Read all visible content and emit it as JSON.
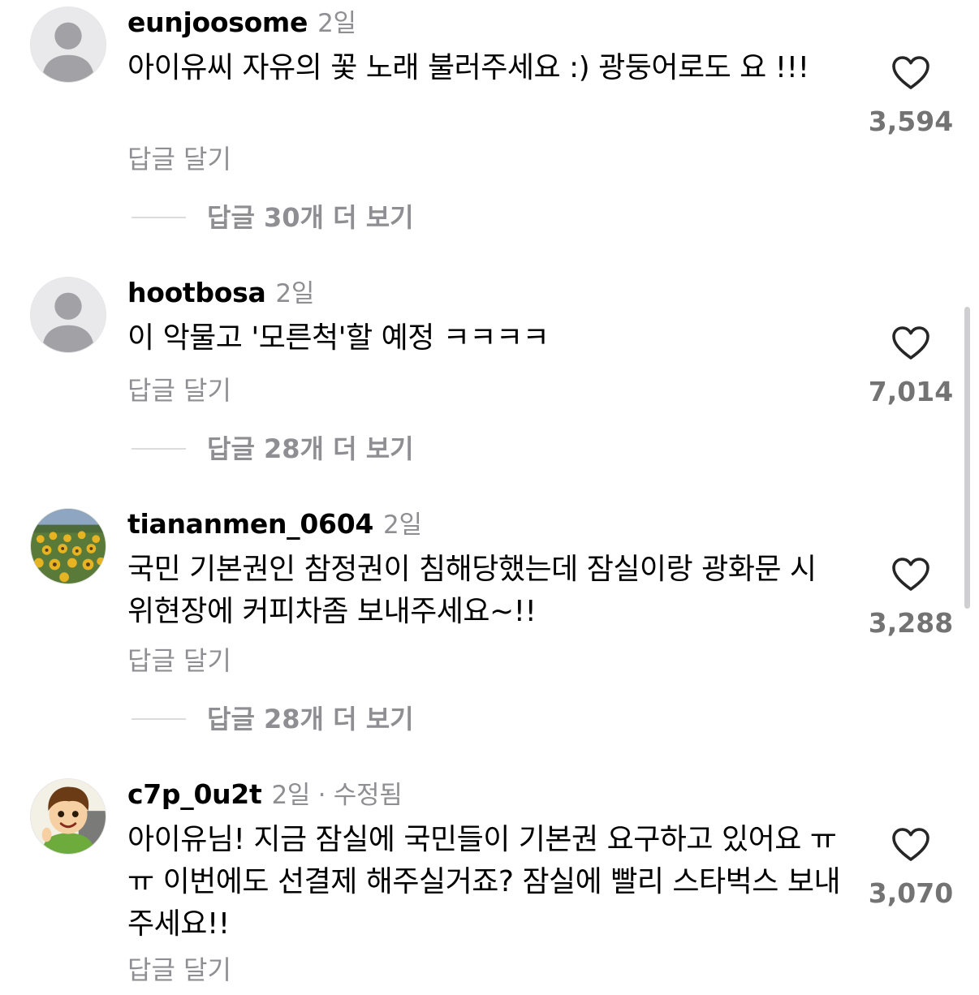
{
  "reply_label": "답글 달기",
  "comments": [
    {
      "username": "eunjoosome",
      "time": "2일",
      "edited": "",
      "text": "아이유씨 자유의 꽃 노래 불러주세요 :) 광둥어로도 요 !!!",
      "likes": "3,594",
      "more_replies": "답글 30개 더 보기"
    },
    {
      "username": "hootbosa",
      "time": "2일",
      "edited": "",
      "text": "이 악물고 '모른척'할 예정 ㅋㅋㅋㅋ",
      "likes": "7,014",
      "more_replies": "답글 28개 더 보기"
    },
    {
      "username": "tiananmen_0604",
      "time": "2일",
      "edited": "",
      "text": "국민 기본권인 참정권이 침해당했는데 잠실이랑 광화문 시위현장에 커피차좀 보내주세요~!!",
      "likes": "3,288",
      "more_replies": "답글 28개 더 보기"
    },
    {
      "username": "c7p_0u2t",
      "time": "2일",
      "edited": " · 수정됨",
      "text": "아이유님! 지금 잠실에 국민들이 기본권 요구하고 있어요 ㅠㅠ 이번에도 선결제 해주실거죠? 잠실에 빨리 스타벅스 보내주세요!!",
      "likes": "3,070",
      "more_replies": ""
    }
  ],
  "icons": {
    "default_avatar": "person-silhouette-icon",
    "heart": "heart-outline-icon"
  },
  "colors": {
    "muted_text": "#8e8e93",
    "like_count": "#737373",
    "avatar_bg": "#e9e9ec",
    "avatar_figure": "#a1a1a6"
  }
}
